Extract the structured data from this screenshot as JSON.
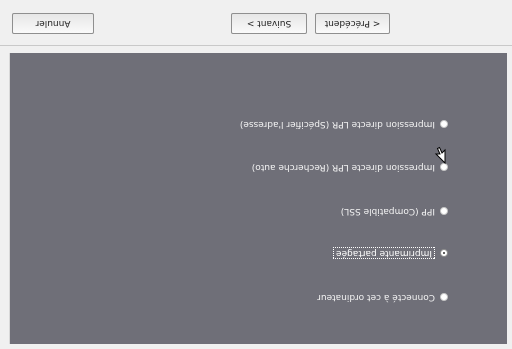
{
  "options": [
    {
      "label": "Connecté à cet ordinateur",
      "selected": false
    },
    {
      "label": "Imprimante partagée",
      "selected": true
    },
    {
      "label": "IPP (Compatible SSL)",
      "selected": false
    },
    {
      "label": "Impression directe LPR (Recherche auto)",
      "selected": false
    },
    {
      "label": "Impression directe LPR (Spécifier l'adresse)",
      "selected": false
    }
  ],
  "buttons": {
    "previous": "< Précédent",
    "next": "Suivant >",
    "cancel": "Annuler"
  },
  "icons": {
    "cursor": "mouse-pointer-icon"
  },
  "colors": {
    "panel": "#6f6f78",
    "bar": "#f0f0f0"
  }
}
